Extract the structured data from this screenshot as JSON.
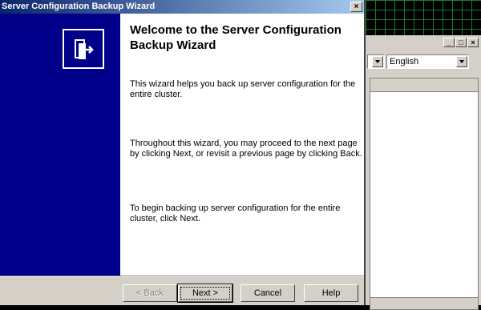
{
  "background": {
    "language_combo": "English"
  },
  "dialog": {
    "title": "Server Configuration Backup Wizard",
    "close_label": "×",
    "heading": "Welcome to the Server Configuration Backup Wizard",
    "paragraphs": [
      "This wizard helps you back up server configuration for the entire cluster.",
      "Throughout this wizard, you may proceed to the next page by clicking Next, or revisit a previous page by clicking Back.",
      "To begin backing up server configuration for the entire cluster, click Next."
    ],
    "buttons": {
      "back": "< Back",
      "next": "Next >",
      "cancel": "Cancel",
      "help": "Help"
    }
  },
  "colors": {
    "left_panel": "#00008b",
    "title_gradient_start": "#0a246a",
    "title_gradient_end": "#a6caf0"
  }
}
